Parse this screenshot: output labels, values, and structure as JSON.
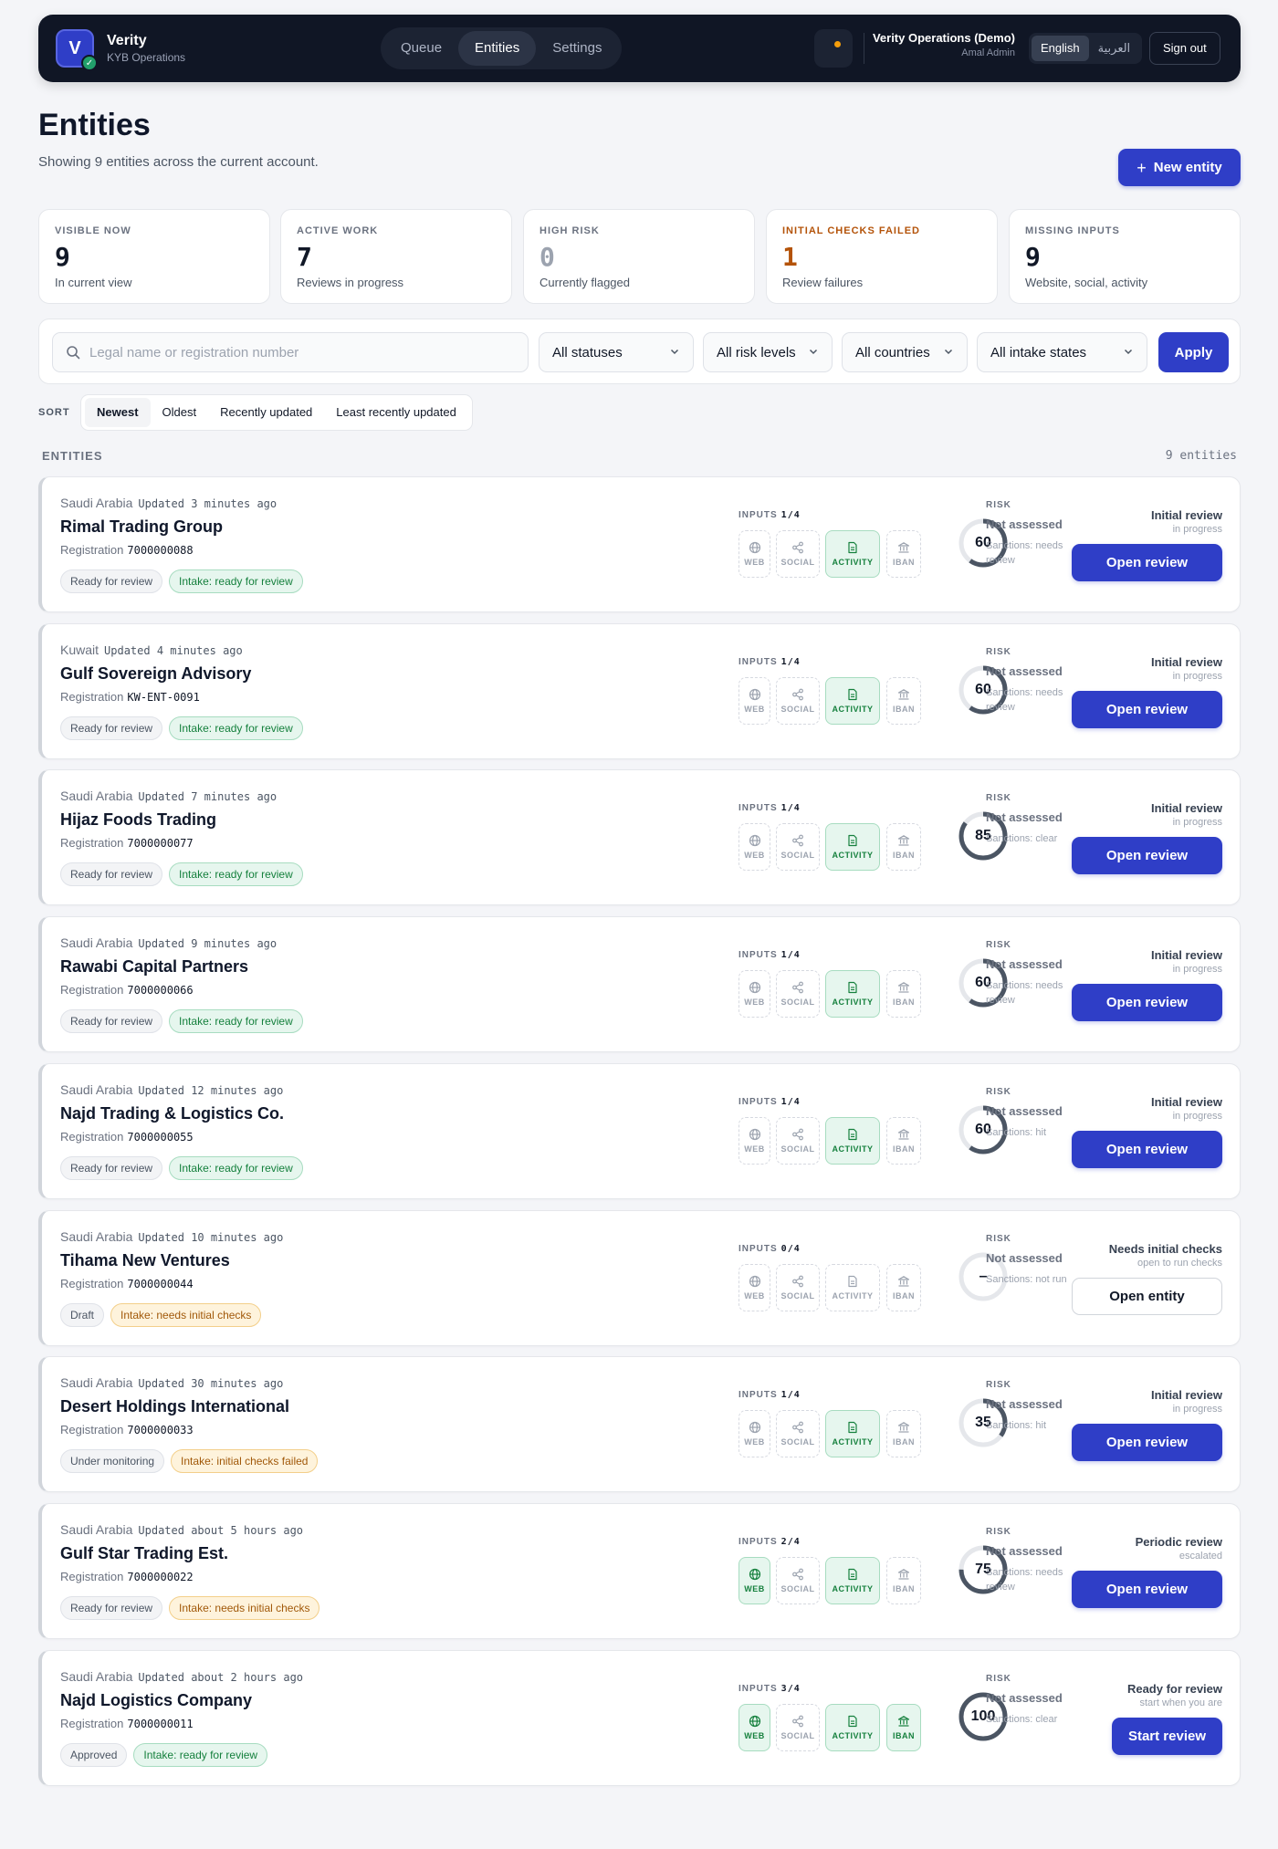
{
  "app": {
    "logo_letter": "V",
    "name": "Verity",
    "subtitle": "KYB Operations"
  },
  "nav": {
    "tabs": [
      {
        "label": "Queue"
      },
      {
        "label": "Entities"
      },
      {
        "label": "Settings"
      }
    ],
    "active": "Entities"
  },
  "account": {
    "org": "Verity Operations (Demo)",
    "user": "Amal Admin"
  },
  "language": {
    "english": "English",
    "arabic": "العربية",
    "active": "English"
  },
  "signout_label": "Sign out",
  "page": {
    "title": "Entities",
    "subtitle": "Showing 9 entities across the current account.",
    "new_entity_label": "New entity"
  },
  "stats": [
    {
      "label": "VISIBLE NOW",
      "value": "9",
      "caption": "In current view",
      "color": "#111827"
    },
    {
      "label": "ACTIVE WORK",
      "value": "7",
      "caption": "Reviews in progress",
      "color": "#111827"
    },
    {
      "label": "HIGH RISK",
      "value": "0",
      "caption": "Currently flagged",
      "color": "#9ca3af"
    },
    {
      "label": "INITIAL CHECKS FAILED",
      "value": "1",
      "caption": "Review failures",
      "color": "#b45309"
    },
    {
      "label": "MISSING INPUTS",
      "value": "9",
      "caption": "Website, social, activity",
      "color": "#111827"
    }
  ],
  "filters": {
    "search_placeholder": "Legal name or registration number",
    "status": "All statuses",
    "risk": "All risk levels",
    "country": "All countries",
    "intake": "All intake states",
    "apply_label": "Apply"
  },
  "sort": {
    "label": "SORT",
    "options": [
      "Newest",
      "Oldest",
      "Recently updated",
      "Least recently updated"
    ],
    "active": "Newest"
  },
  "list": {
    "label": "ENTITIES",
    "count": "9 entities"
  },
  "chip_labels": {
    "web": "WEB",
    "social": "SOCIAL",
    "activity": "ACTIVITY",
    "iban": "IBAN"
  },
  "labels": {
    "registration": "Registration",
    "inputs": "INPUTS",
    "risk": "RISK"
  },
  "colors": {
    "accent": "#2f3ec7",
    "green": "#15803d",
    "amber": "#a1590a"
  },
  "entities": [
    {
      "country": "Saudi Arabia",
      "updated": "Updated 3 minutes ago",
      "name": "Rimal Trading Group",
      "registration": "7000000088",
      "status": "Ready for review",
      "intake": "Intake: ready for review",
      "intake_tone": "green",
      "inputs": "1/4",
      "web": false,
      "social": false,
      "activity": true,
      "iban": false,
      "score": "60",
      "score_value": 60,
      "risk": "Not assessed",
      "sanctions": "Sanctions: needs review",
      "stage": "Initial review",
      "stage_sub": "in progress",
      "action": "Open review",
      "action_style": "primary"
    },
    {
      "country": "Kuwait",
      "updated": "Updated 4 minutes ago",
      "name": "Gulf Sovereign Advisory",
      "registration": "KW-ENT-0091",
      "status": "Ready for review",
      "intake": "Intake: ready for review",
      "intake_tone": "green",
      "inputs": "1/4",
      "web": false,
      "social": false,
      "activity": true,
      "iban": false,
      "score": "60",
      "score_value": 60,
      "risk": "Not assessed",
      "sanctions": "Sanctions: needs review",
      "stage": "Initial review",
      "stage_sub": "in progress",
      "action": "Open review",
      "action_style": "primary"
    },
    {
      "country": "Saudi Arabia",
      "updated": "Updated 7 minutes ago",
      "name": "Hijaz Foods Trading",
      "registration": "7000000077",
      "status": "Ready for review",
      "intake": "Intake: ready for review",
      "intake_tone": "green",
      "inputs": "1/4",
      "web": false,
      "social": false,
      "activity": true,
      "iban": false,
      "score": "85",
      "score_value": 85,
      "risk": "Not assessed",
      "sanctions": "Sanctions: clear",
      "stage": "Initial review",
      "stage_sub": "in progress",
      "action": "Open review",
      "action_style": "primary"
    },
    {
      "country": "Saudi Arabia",
      "updated": "Updated 9 minutes ago",
      "name": "Rawabi Capital Partners",
      "registration": "7000000066",
      "status": "Ready for review",
      "intake": "Intake: ready for review",
      "intake_tone": "green",
      "inputs": "1/4",
      "web": false,
      "social": false,
      "activity": true,
      "iban": false,
      "score": "60",
      "score_value": 60,
      "risk": "Not assessed",
      "sanctions": "Sanctions: needs review",
      "stage": "Initial review",
      "stage_sub": "in progress",
      "action": "Open review",
      "action_style": "primary"
    },
    {
      "country": "Saudi Arabia",
      "updated": "Updated 12 minutes ago",
      "name": "Najd Trading & Logistics Co.",
      "registration": "7000000055",
      "status": "Ready for review",
      "intake": "Intake: ready for review",
      "intake_tone": "green",
      "inputs": "1/4",
      "web": false,
      "social": false,
      "activity": true,
      "iban": false,
      "score": "60",
      "score_value": 60,
      "risk": "Not assessed",
      "sanctions": "Sanctions: hit",
      "stage": "Initial review",
      "stage_sub": "in progress",
      "action": "Open review",
      "action_style": "primary"
    },
    {
      "country": "Saudi Arabia",
      "updated": "Updated 10 minutes ago",
      "name": "Tihama New Ventures",
      "registration": "7000000044",
      "status": "Draft",
      "intake": "Intake: needs initial checks",
      "intake_tone": "amber",
      "inputs": "0/4",
      "web": false,
      "social": false,
      "activity": false,
      "iban": false,
      "score": "–",
      "score_value": 0,
      "risk": "Not assessed",
      "sanctions": "Sanctions: not run",
      "stage": "Needs initial checks",
      "stage_sub": "open to run checks",
      "action": "Open entity",
      "action_style": "outline"
    },
    {
      "country": "Saudi Arabia",
      "updated": "Updated 30 minutes ago",
      "name": "Desert Holdings International",
      "registration": "7000000033",
      "status": "Under monitoring",
      "intake": "Intake: initial checks failed",
      "intake_tone": "amber",
      "inputs": "1/4",
      "web": false,
      "social": false,
      "activity": true,
      "iban": false,
      "score": "35",
      "score_value": 35,
      "risk": "Not assessed",
      "sanctions": "Sanctions: hit",
      "stage": "Initial review",
      "stage_sub": "in progress",
      "action": "Open review",
      "action_style": "primary"
    },
    {
      "country": "Saudi Arabia",
      "updated": "Updated about 5 hours ago",
      "name": "Gulf Star Trading Est.",
      "registration": "7000000022",
      "status": "Ready for review",
      "intake": "Intake: needs initial checks",
      "intake_tone": "amber",
      "inputs": "2/4",
      "web": true,
      "social": false,
      "activity": true,
      "iban": false,
      "score": "75",
      "score_value": 75,
      "risk": "Not assessed",
      "sanctions": "Sanctions: needs review",
      "stage": "Periodic review",
      "stage_sub": "escalated",
      "action": "Open review",
      "action_style": "primary"
    },
    {
      "country": "Saudi Arabia",
      "updated": "Updated about 2 hours ago",
      "name": "Najd Logistics Company",
      "registration": "7000000011",
      "status": "Approved",
      "intake": "Intake: ready for review",
      "intake_tone": "green",
      "inputs": "3/4",
      "web": true,
      "social": false,
      "activity": true,
      "iban": true,
      "score": "100",
      "score_value": 100,
      "risk": "Not assessed",
      "sanctions": "Sanctions: clear",
      "stage": "Ready for review",
      "stage_sub": "start when you are",
      "action": "Start review",
      "action_style": "primary"
    }
  ]
}
